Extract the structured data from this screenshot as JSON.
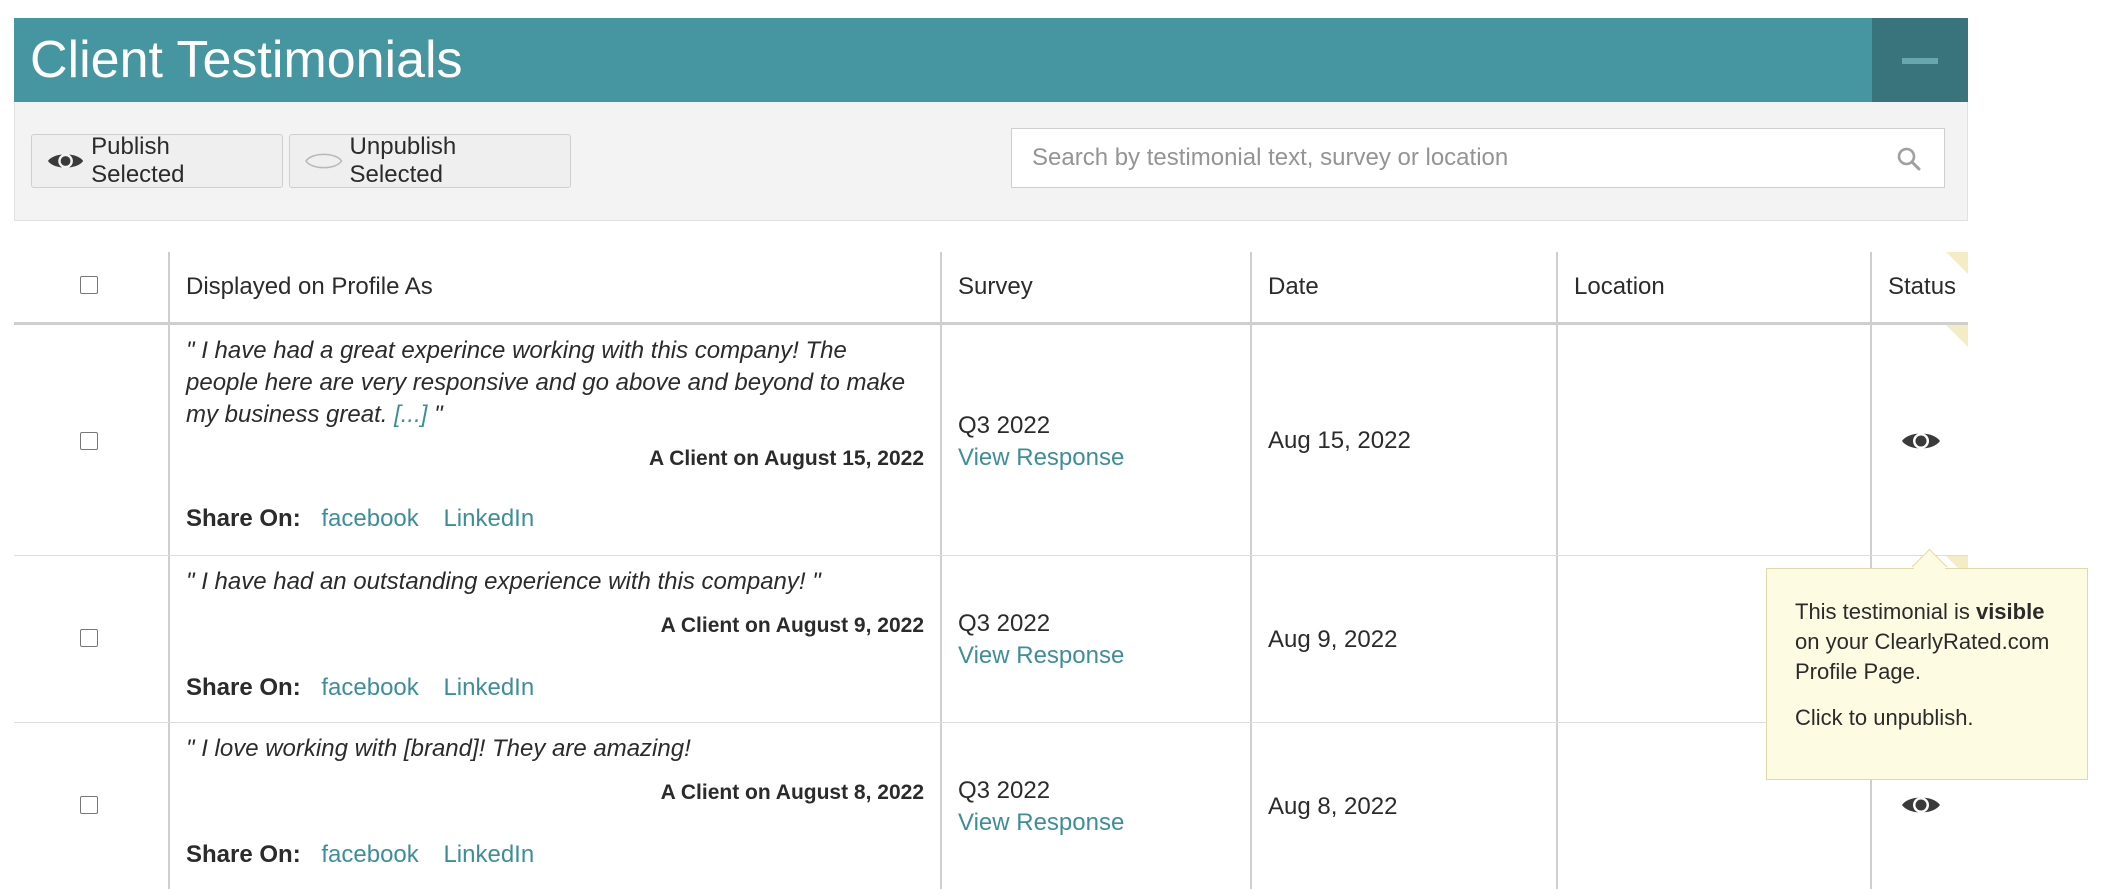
{
  "panel": {
    "title": "Client Testimonials"
  },
  "toolbar": {
    "publish_label": "Publish Selected",
    "unpublish_label": "Unpublish Selected",
    "search_placeholder": "Search by testimonial text, survey or location"
  },
  "table": {
    "headers": {
      "displayed": "Displayed on Profile As",
      "survey": "Survey",
      "date": "Date",
      "location": "Location",
      "status": "Status"
    },
    "rows": [
      {
        "quote": "\" I have had a great experince working with this company! The people here are very responsive and go above and beyond to make my business great.",
        "more": "[...]",
        "quote_end": " \"",
        "byline": "A Client on August 15, 2022",
        "share_label": "Share On:",
        "share_links": [
          "facebook",
          "LinkedIn"
        ],
        "survey": "Q3 2022",
        "survey_link": "View Response",
        "date": "Aug 15, 2022",
        "location": "",
        "status_icon": "eye-icon"
      },
      {
        "quote": "\" I have had an outstanding experience with this company! \"",
        "byline": "A Client on August 9, 2022",
        "share_label": "Share On:",
        "share_links": [
          "facebook",
          "LinkedIn"
        ],
        "survey": "Q3 2022",
        "survey_link": "View Response",
        "date": "Aug 9, 2022",
        "location": "",
        "status_icon": "eye-icon"
      },
      {
        "quote": "\" I love working with [brand]! They are amazing!",
        "byline": "A Client on August 8, 2022",
        "share_label": "Share On:",
        "share_links": [
          "facebook",
          "LinkedIn"
        ],
        "survey": "Q3 2022",
        "survey_link": "View Response",
        "date": "Aug 8, 2022",
        "location": "",
        "status_icon": "eye-icon"
      }
    ]
  },
  "tooltip": {
    "line1_pre": "This testimonial is ",
    "line1_bold": "visible",
    "line1_post": " on your ClearlyRated.com Profile Page.",
    "line2": "Click to unpublish."
  },
  "colors": {
    "header_bg": "#4696a1",
    "collapse_bg": "#39737c",
    "link": "#3e8e99",
    "tooltip_bg": "#fefbe3"
  }
}
